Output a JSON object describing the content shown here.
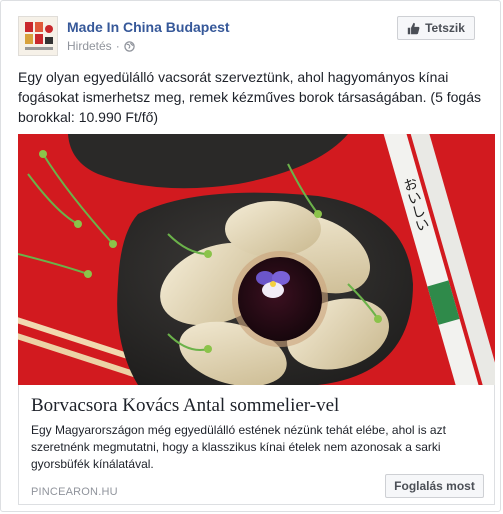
{
  "post": {
    "page_name": "Made In China Budapest",
    "sponsored_label": "Hirdetés",
    "separator": "·",
    "audience_icon": "globe-icon",
    "like_button_label": "Tetszik",
    "like_icon": "thumbs-up-icon",
    "text": "Egy olyan egyedülálló vacsorát szerveztünk, ahol hagyományos kínai fogásokat ismerhetsz meg, remek kézműves borok társaságában. (5 fogás borokkal: 10.990 Ft/fő)"
  },
  "image": {
    "chopsticks_text": "おいしい",
    "background_color": "#d21a1f",
    "plate_color": "#2c2b2a"
  },
  "link": {
    "title": "Borvacsora Kovács Antal sommelier-vel",
    "description": "Egy Magyarországon még egyedülálló estének nézünk tehát elébe, ahol is azt szeretnénk megmutatni, hogy a klasszikus kínai ételek nem azonosak a sarki gyorsbüfék kínálatával.",
    "domain": "PINCEARON.HU",
    "cta_label": "Foglalás most"
  },
  "colors": {
    "link_blue": "#365899",
    "meta_gray": "#90949c",
    "border": "#dddfe2"
  }
}
